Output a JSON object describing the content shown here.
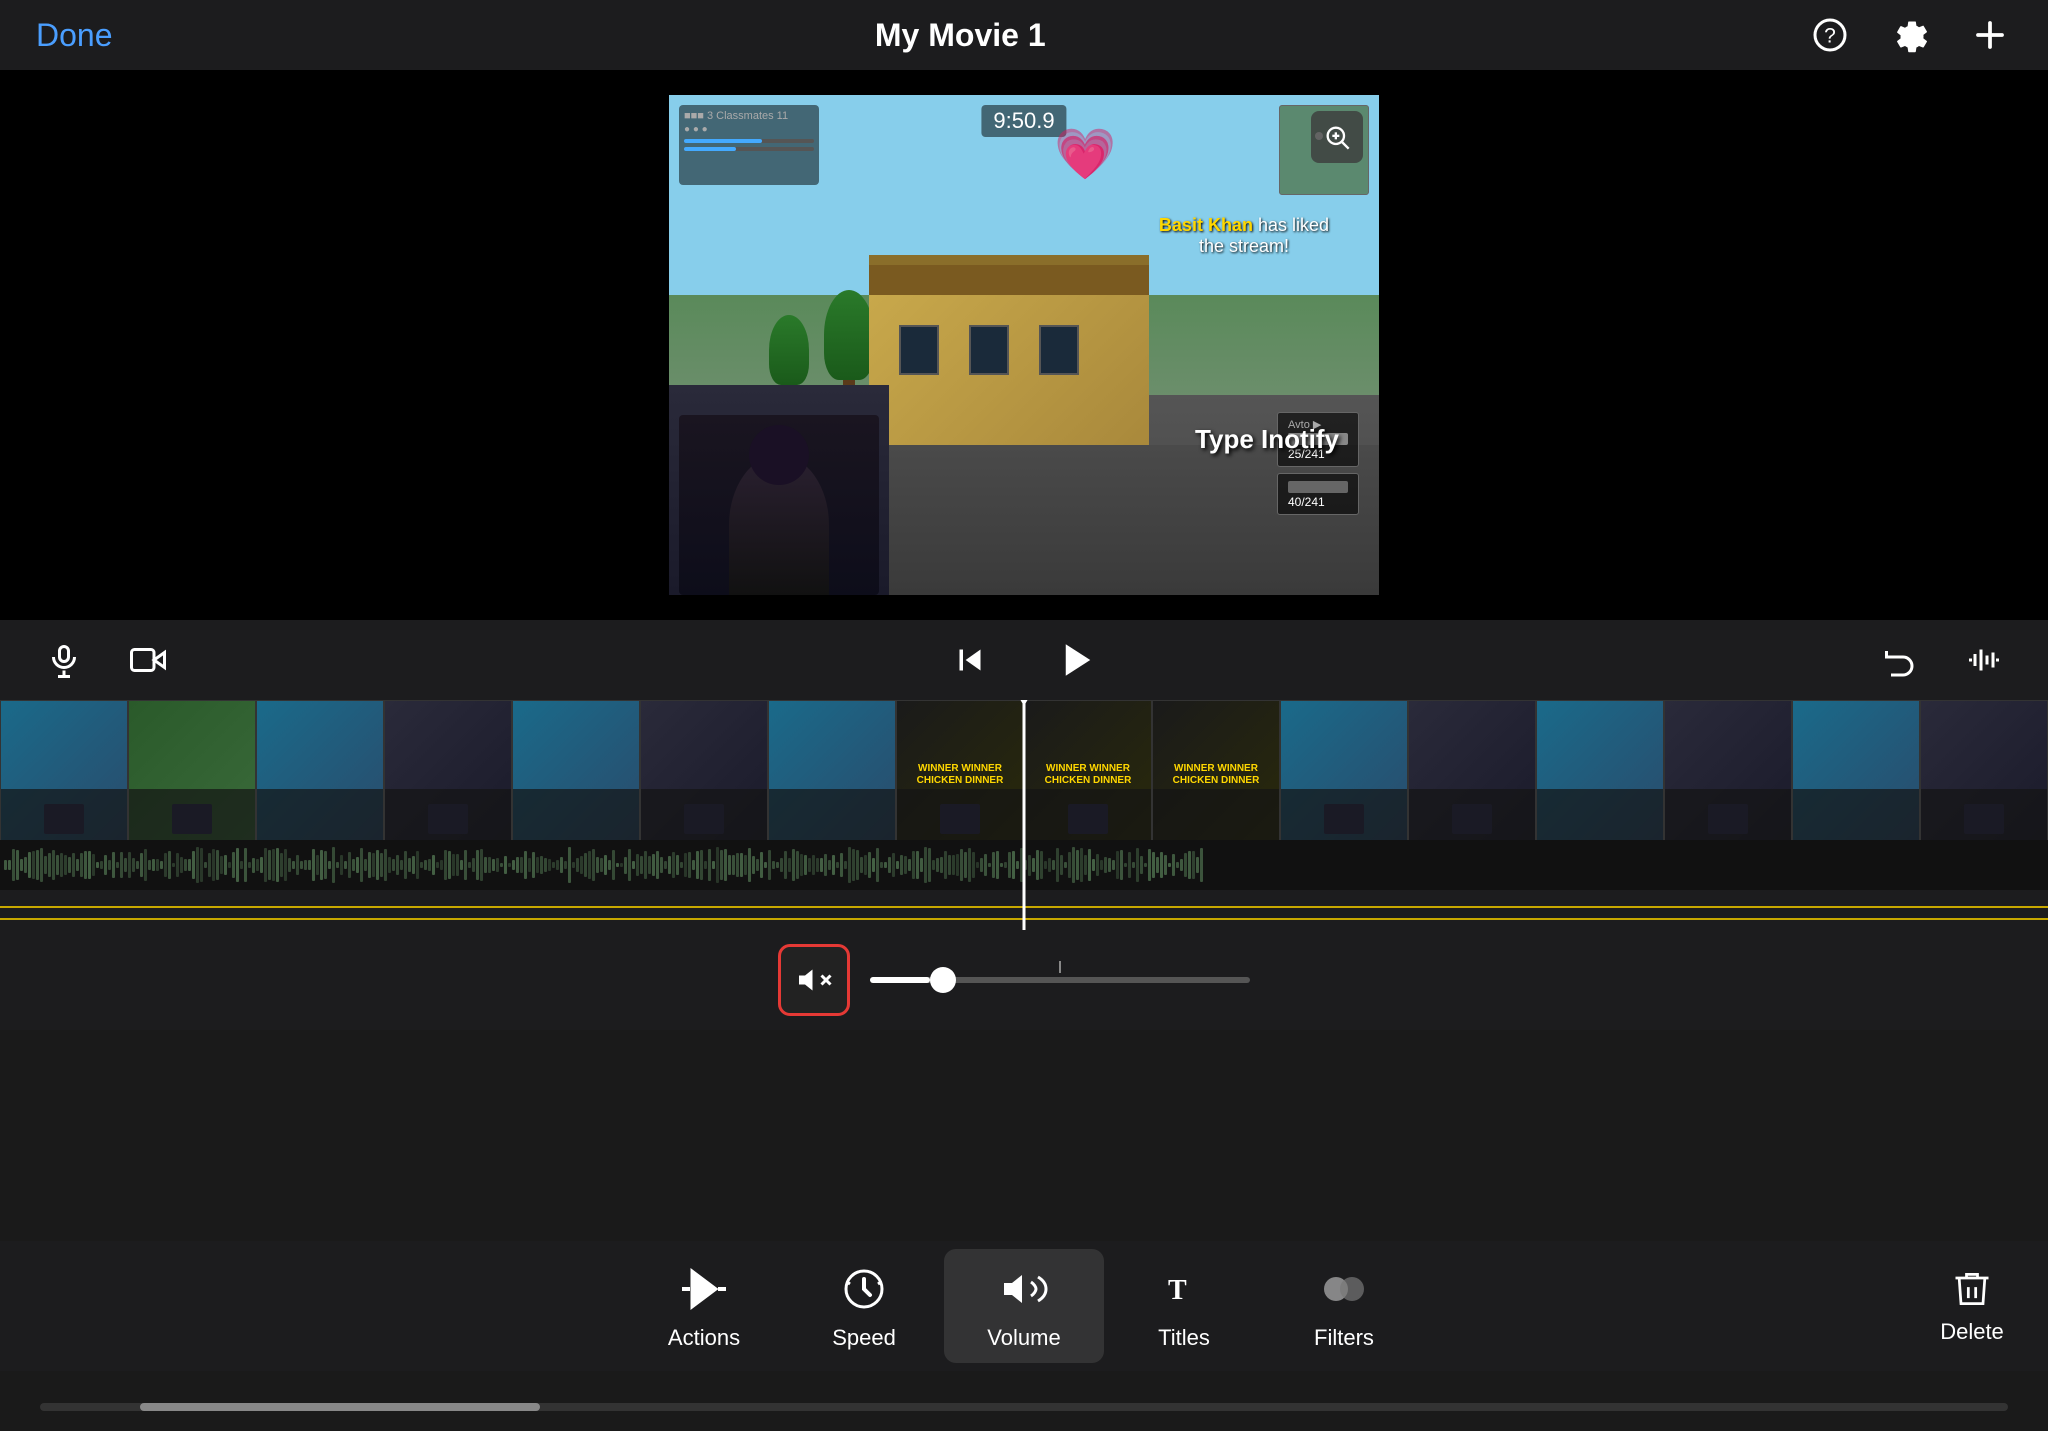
{
  "header": {
    "done_label": "Done",
    "title": "My Movie 1",
    "help_icon": "help-icon",
    "settings_icon": "settings-icon",
    "add_icon": "add-icon"
  },
  "preview": {
    "hud_time": "9:50.9",
    "notification": "Basit Khan has liked the stream!",
    "type_inotify": "Type Inotify",
    "weapon1": "25/241",
    "weapon2": "40/241"
  },
  "playback": {
    "skip_back_icon": "skip-back-icon",
    "play_icon": "play-icon",
    "mic_icon": "mic-icon",
    "camera_icon": "camera-icon",
    "undo_icon": "undo-icon",
    "waveform_icon": "waveform-icon"
  },
  "volume": {
    "mute_label": "mute-icon",
    "slider_value": 60,
    "slider_max": 380
  },
  "toolbar": {
    "actions_label": "Actions",
    "speed_label": "Speed",
    "volume_label": "Volume",
    "titles_label": "Titles",
    "filters_label": "Filters",
    "delete_label": "Delete"
  },
  "timeline": {
    "thumbs": [
      {
        "color": "blue"
      },
      {
        "color": "green"
      },
      {
        "color": "blue"
      },
      {
        "color": "dark"
      },
      {
        "color": "blue"
      },
      {
        "color": "dark"
      },
      {
        "color": "blue"
      },
      {
        "color": "yellow"
      },
      {
        "color": "yellow"
      },
      {
        "color": "yellow"
      },
      {
        "color": "blue"
      },
      {
        "color": "dark"
      },
      {
        "color": "blue"
      },
      {
        "color": "dark"
      },
      {
        "color": "blue"
      },
      {
        "color": "dark"
      }
    ]
  }
}
